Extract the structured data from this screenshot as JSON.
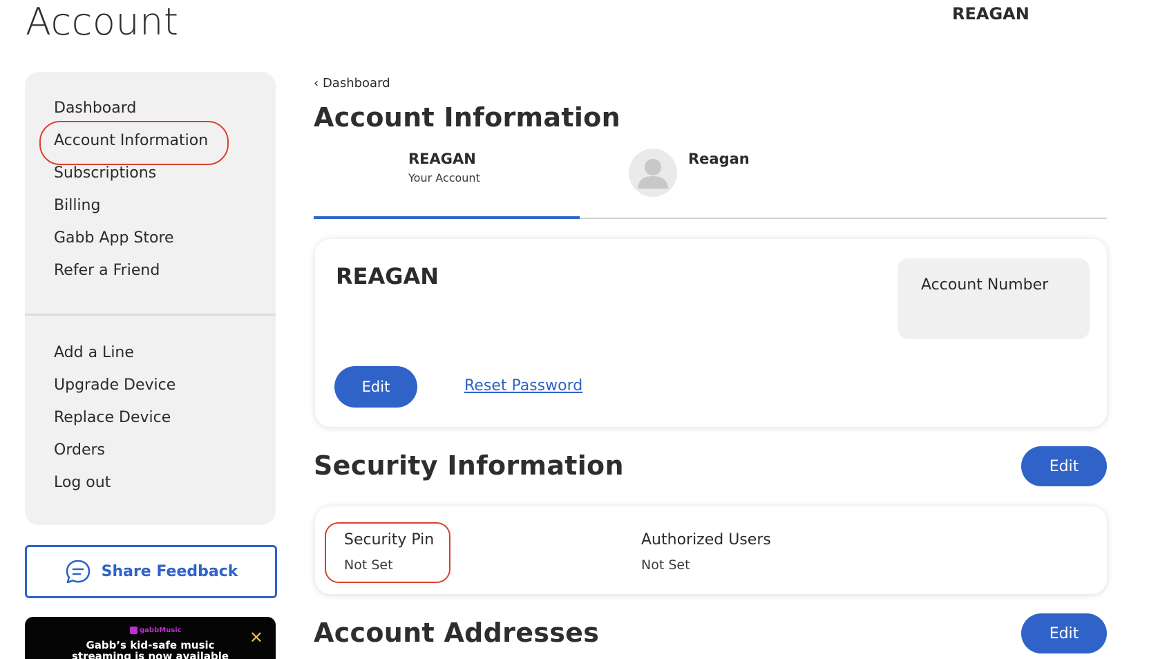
{
  "header": {
    "page_title": "Account",
    "user_name": "REAGAN"
  },
  "sidebar": {
    "primary_items": [
      {
        "label": "Dashboard"
      },
      {
        "label": "Account Information"
      },
      {
        "label": "Subscriptions"
      },
      {
        "label": "Billing"
      },
      {
        "label": "Gabb App Store"
      },
      {
        "label": "Refer a Friend"
      }
    ],
    "secondary_items": [
      {
        "label": "Add a Line"
      },
      {
        "label": "Upgrade Device"
      },
      {
        "label": "Replace Device"
      },
      {
        "label": "Orders"
      },
      {
        "label": "Log out"
      }
    ],
    "highlight_color": "#d9412d"
  },
  "feedback": {
    "label": "Share Feedback",
    "icon": "chat-bubble-icon"
  },
  "promo": {
    "brand": "gabbMusic",
    "text_line1": "Gabb’s kid-safe music",
    "text_line2": "streaming is now available",
    "close_icon": "close-icon"
  },
  "main": {
    "breadcrumb": {
      "chevron": "‹",
      "label": "Dashboard"
    },
    "title": "Account Information",
    "tabs": [
      {
        "name": "REAGAN",
        "sub": "Your Account",
        "active": true
      },
      {
        "name": "Reagan",
        "sub": "",
        "active": false,
        "icon": "user-avatar-icon"
      }
    ],
    "account_card": {
      "name": "REAGAN",
      "account_number_label": "Account Number",
      "edit_label": "Edit",
      "reset_password_label": "Reset Password"
    },
    "security": {
      "title": "Security Information",
      "edit_label": "Edit",
      "pin_label": "Security Pin",
      "pin_value": "Not Set",
      "users_label": "Authorized Users",
      "users_value": "Not Set"
    },
    "addresses": {
      "title": "Account Addresses",
      "edit_label": "Edit"
    }
  },
  "colors": {
    "accent": "#2f63c8",
    "sidebar_bg": "#f1f1f1",
    "annotation": "#d9412d"
  }
}
